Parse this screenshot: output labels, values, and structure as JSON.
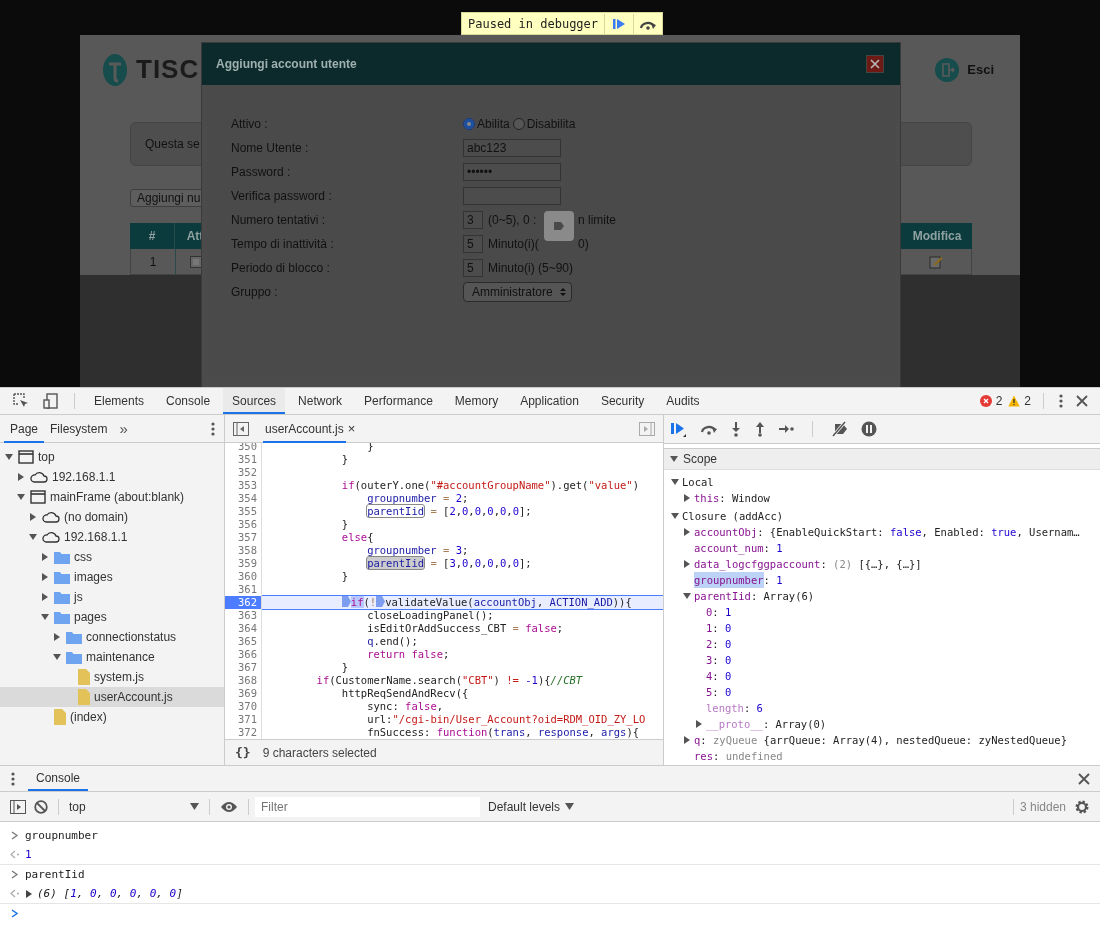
{
  "debugger_banner": {
    "text": "Paused in debugger"
  },
  "webpage": {
    "logo": "TISC",
    "logout": "Esci",
    "notice": "Questa se",
    "add_button": "Aggiungi nu",
    "table": {
      "columns": [
        "#",
        "Att",
        "Modifica"
      ],
      "rows": [
        {
          "cells": [
            "1"
          ],
          "enabled": true
        }
      ]
    }
  },
  "modal": {
    "title": "Aggiungi account utente",
    "fields": [
      {
        "kind": "radio",
        "label": "Attivo :",
        "options": [
          {
            "label": "Abilita",
            "selected": true
          },
          {
            "label": "Disabilita",
            "selected": false
          }
        ]
      },
      {
        "kind": "text",
        "label": "Nome Utente :",
        "value": "abc123"
      },
      {
        "kind": "text",
        "label": "Password :",
        "value": "••••••"
      },
      {
        "kind": "text",
        "label": "Verifica password :"
      },
      {
        "kind": "short",
        "label": "Numero tentativi :",
        "value": "3",
        "hint": "(0~5), 0 :",
        "hint_after": "n limite"
      },
      {
        "kind": "short",
        "label": "Tempo di inattività :",
        "value": "5",
        "hint": "Minuto(i)(",
        "hint_after": "0)"
      },
      {
        "kind": "short",
        "label": "Periodo di blocco :",
        "value": "5",
        "hint": "Minuto(i) (5~90)"
      },
      {
        "kind": "select",
        "label": "Gruppo :",
        "value": "Amministratore"
      }
    ]
  },
  "devtools": {
    "tabs": [
      {
        "label": "Elements",
        "selected": false
      },
      {
        "label": "Console",
        "selected": false
      },
      {
        "label": "Sources",
        "selected": true
      },
      {
        "label": "Network",
        "selected": false
      },
      {
        "label": "Performance",
        "selected": false
      },
      {
        "label": "Memory",
        "selected": false
      },
      {
        "label": "Application",
        "selected": false
      },
      {
        "label": "Security",
        "selected": false
      },
      {
        "label": "Audits",
        "selected": false
      }
    ],
    "errors": "2",
    "warnings": "2"
  },
  "navigator": {
    "tabs": [
      {
        "label": "Page",
        "selected": true
      },
      {
        "label": "Filesystem",
        "selected": false
      }
    ],
    "more": "»",
    "tree": [
      {
        "label": "top",
        "kind": "frame",
        "expanded": true,
        "selected": false,
        "children": [
          {
            "label": "192.168.1.1",
            "kind": "cloud",
            "expanded": false,
            "selected": false
          },
          {
            "label": "mainFrame (about:blank)",
            "kind": "frame",
            "expanded": true,
            "selected": false,
            "children": [
              {
                "label": "(no domain)",
                "kind": "cloud",
                "expanded": false,
                "selected": false
              },
              {
                "label": "192.168.1.1",
                "kind": "cloud",
                "expanded": true,
                "selected": false,
                "children": [
                  {
                    "label": "css",
                    "kind": "folder",
                    "expanded": false,
                    "selected": false
                  },
                  {
                    "label": "images",
                    "kind": "folder",
                    "expanded": false,
                    "selected": false
                  },
                  {
                    "label": "js",
                    "kind": "folder",
                    "expanded": false,
                    "selected": false
                  },
                  {
                    "label": "pages",
                    "kind": "folder",
                    "expanded": true,
                    "selected": false,
                    "children": [
                      {
                        "label": "connectionstatus",
                        "kind": "folder",
                        "expanded": false,
                        "selected": false
                      },
                      {
                        "label": "maintenance",
                        "kind": "folder",
                        "expanded": true,
                        "selected": false,
                        "children": [
                          {
                            "label": "system.js",
                            "kind": "file",
                            "selected": false
                          },
                          {
                            "label": "userAccount.js",
                            "kind": "file",
                            "selected": true
                          }
                        ]
                      }
                    ]
                  },
                  {
                    "label": "(index)",
                    "kind": "file",
                    "selected": false
                  }
                ]
              }
            ]
          }
        ]
      }
    ]
  },
  "editor": {
    "file_tab": "userAccount.js",
    "close": "×",
    "status": "9 characters selected",
    "pretty_print": "{}",
    "lines": [
      {
        "n": "350",
        "current": false,
        "tokens": [
          {
            "text": "                }",
            "kind": "plain"
          }
        ]
      },
      {
        "n": "351",
        "current": false,
        "tokens": [
          {
            "text": "            }",
            "kind": "plain"
          }
        ]
      },
      {
        "n": "352",
        "current": false
      },
      {
        "n": "353",
        "current": false,
        "tokens": [
          {
            "text": "            if",
            "kind": "keyword"
          },
          {
            "text": "(outerY.one(",
            "kind": "plain"
          },
          {
            "text": "\"#accountGroupName\"",
            "kind": "string"
          },
          {
            "text": ").get(",
            "kind": "plain"
          },
          {
            "text": "\"value\"",
            "kind": "string"
          },
          {
            "text": ")",
            "kind": "plain"
          }
        ]
      },
      {
        "n": "354",
        "current": false,
        "tokens": [
          {
            "text": "                groupnumber",
            "kind": "variable"
          },
          {
            "text": " = ",
            "kind": "operator"
          },
          {
            "text": "2",
            "kind": "number"
          },
          {
            "text": ";",
            "kind": "plain"
          }
        ]
      },
      {
        "n": "355",
        "current": false,
        "tokens": [
          {
            "text": "                parentIid",
            "kind": "variable",
            "boxed": true
          },
          {
            "text": " = ",
            "kind": "operator"
          },
          {
            "text": "[",
            "kind": "plain"
          },
          {
            "text": "2",
            "kind": "number"
          },
          {
            "text": ",",
            "kind": "plain"
          },
          {
            "text": "0",
            "kind": "number"
          },
          {
            "text": ",",
            "kind": "plain"
          },
          {
            "text": "0",
            "kind": "number"
          },
          {
            "text": ",",
            "kind": "plain"
          },
          {
            "text": "0",
            "kind": "number"
          },
          {
            "text": ",",
            "kind": "plain"
          },
          {
            "text": "0",
            "kind": "number"
          },
          {
            "text": ",",
            "kind": "plain"
          },
          {
            "text": "0",
            "kind": "number"
          },
          {
            "text": "];",
            "kind": "plain"
          }
        ]
      },
      {
        "n": "356",
        "current": false,
        "tokens": [
          {
            "text": "            }",
            "kind": "plain"
          }
        ]
      },
      {
        "n": "357",
        "current": false,
        "tokens": [
          {
            "text": "            else",
            "kind": "keyword"
          },
          {
            "text": "{",
            "kind": "plain"
          }
        ]
      },
      {
        "n": "358",
        "current": false,
        "tokens": [
          {
            "text": "                groupnumber",
            "kind": "variable"
          },
          {
            "text": " = ",
            "kind": "operator"
          },
          {
            "text": "3",
            "kind": "number"
          },
          {
            "text": ";",
            "kind": "plain"
          }
        ]
      },
      {
        "n": "359",
        "current": false,
        "tokens": [
          {
            "text": "                parentIid",
            "kind": "variable",
            "boxed": true,
            "selected": true
          },
          {
            "text": " = ",
            "kind": "operator"
          },
          {
            "text": "[",
            "kind": "plain"
          },
          {
            "text": "3",
            "kind": "number"
          },
          {
            "text": ",",
            "kind": "plain"
          },
          {
            "text": "0",
            "kind": "number"
          },
          {
            "text": ",",
            "kind": "plain"
          },
          {
            "text": "0",
            "kind": "number"
          },
          {
            "text": ",",
            "kind": "plain"
          },
          {
            "text": "0",
            "kind": "number"
          },
          {
            "text": ",",
            "kind": "plain"
          },
          {
            "text": "0",
            "kind": "number"
          },
          {
            "text": ",",
            "kind": "plain"
          },
          {
            "text": "0",
            "kind": "number"
          },
          {
            "text": "];",
            "kind": "plain"
          }
        ]
      },
      {
        "n": "360",
        "current": false,
        "tokens": [
          {
            "text": "            }",
            "kind": "plain"
          }
        ]
      },
      {
        "n": "361",
        "current": false
      },
      {
        "n": "362",
        "current": true,
        "tokens": [
          {
            "text": "            if",
            "kind": "keyword",
            "paused_here": true,
            "breakpoint_before": true
          },
          {
            "text": "(",
            "kind": "plain"
          },
          {
            "text": "!",
            "kind": "operator"
          },
          {
            "kind": "breakpoint"
          },
          {
            "text": "validateValue(",
            "kind": "plain"
          },
          {
            "text": "accountObj",
            "kind": "variable"
          },
          {
            "text": ", ",
            "kind": "plain"
          },
          {
            "text": "ACTION_ADD",
            "kind": "variable"
          },
          {
            "text": ")){",
            "kind": "plain"
          }
        ]
      },
      {
        "n": "363",
        "current": false,
        "tokens": [
          {
            "text": "                closeLoadingPanel();",
            "kind": "plain"
          }
        ]
      },
      {
        "n": "364",
        "current": false,
        "tokens": [
          {
            "text": "                isEditOrAddSuccess_CBT",
            "kind": "plain"
          },
          {
            "text": " = ",
            "kind": "operator"
          },
          {
            "text": "false",
            "kind": "keyword"
          },
          {
            "text": ";",
            "kind": "plain"
          }
        ]
      },
      {
        "n": "365",
        "current": false,
        "tokens": [
          {
            "text": "                q",
            "kind": "variable"
          },
          {
            "text": ".end();",
            "kind": "plain"
          }
        ]
      },
      {
        "n": "366",
        "current": false,
        "tokens": [
          {
            "text": "                return false",
            "kind": "keyword"
          },
          {
            "text": ";",
            "kind": "plain"
          }
        ]
      },
      {
        "n": "367",
        "current": false,
        "tokens": [
          {
            "text": "            }",
            "kind": "plain"
          }
        ]
      },
      {
        "n": "368",
        "current": false,
        "tokens": [
          {
            "text": "        if",
            "kind": "keyword"
          },
          {
            "text": "(CustomerName.search(",
            "kind": "plain"
          },
          {
            "text": "\"CBT\"",
            "kind": "string"
          },
          {
            "text": ") ",
            "kind": "plain"
          },
          {
            "text": "!=",
            "kind": "compare"
          },
          {
            "text": " -1",
            "kind": "number"
          },
          {
            "text": "){",
            "kind": "plain"
          },
          {
            "text": "//CBT",
            "kind": "comment"
          }
        ]
      },
      {
        "n": "369",
        "current": false,
        "tokens": [
          {
            "text": "            httpReqSendAndRecv({",
            "kind": "plain"
          }
        ]
      },
      {
        "n": "370",
        "current": false,
        "tokens": [
          {
            "text": "                sync: ",
            "kind": "plain"
          },
          {
            "text": "false",
            "kind": "keyword"
          },
          {
            "text": ",",
            "kind": "plain"
          }
        ]
      },
      {
        "n": "371",
        "current": false,
        "tokens": [
          {
            "text": "                url:",
            "kind": "plain"
          },
          {
            "text": "\"/cgi-bin/User_Account?oid=RDM_OID_ZY_LO",
            "kind": "string"
          }
        ]
      },
      {
        "n": "372",
        "current": false,
        "tokens": [
          {
            "text": "                fnSuccess: ",
            "kind": "plain"
          },
          {
            "text": "function",
            "kind": "keyword"
          },
          {
            "text": "(",
            "kind": "plain"
          },
          {
            "text": "trans",
            "kind": "variable"
          },
          {
            "text": ", ",
            "kind": "plain"
          },
          {
            "text": "response",
            "kind": "variable"
          },
          {
            "text": ", ",
            "kind": "plain"
          },
          {
            "text": "args",
            "kind": "variable"
          },
          {
            "text": "){",
            "kind": "plain"
          }
        ]
      }
    ]
  },
  "scope": {
    "title": "Scope",
    "sections": [
      {
        "title": "Local",
        "entries": [
          {
            "name": "this",
            "internal": false,
            "highlighted": false,
            "expanded": false,
            "value": [
              {
                "text": ": Window",
                "kind": "plain"
              }
            ]
          }
        ]
      },
      {
        "title": "Closure (addAcc)",
        "entries": [
          {
            "name": "accountObj",
            "internal": false,
            "highlighted": false,
            "expanded": false,
            "value": [
              {
                "text": ": {EnableQuickStart: ",
                "kind": "plain"
              },
              {
                "text": "false",
                "kind": "number"
              },
              {
                "text": ", Enabled: ",
                "kind": "plain"
              },
              {
                "text": "true",
                "kind": "number"
              },
              {
                "text": ", Usernam…",
                "kind": "plain"
              }
            ]
          },
          {
            "name": "account_num",
            "internal": false,
            "highlighted": false,
            "value": [
              {
                "text": ": ",
                "kind": "plain"
              },
              {
                "text": "1",
                "kind": "number"
              }
            ]
          },
          {
            "name": "data_logcfggpaccount",
            "internal": false,
            "highlighted": false,
            "expanded": false,
            "value": [
              {
                "text": ": ",
                "kind": "plain"
              },
              {
                "text": "(2) ",
                "kind": "grey"
              },
              {
                "text": "[{…}, {…}]",
                "kind": "plain"
              }
            ]
          },
          {
            "name": "groupnumber",
            "internal": false,
            "highlighted": true,
            "value": [
              {
                "text": ": ",
                "kind": "plain"
              },
              {
                "text": "1",
                "kind": "number"
              }
            ]
          },
          {
            "name": "parentIid",
            "internal": false,
            "highlighted": false,
            "expanded": true,
            "value": [
              {
                "text": ": Array(6)",
                "kind": "plain"
              }
            ],
            "children": [
              {
                "name": "0",
                "internal": false,
                "highlighted": false,
                "value": [
                  {
                    "text": ": ",
                    "kind": "plain"
                  },
                  {
                    "text": "1",
                    "kind": "number"
                  }
                ]
              },
              {
                "name": "1",
                "internal": false,
                "highlighted": false,
                "value": [
                  {
                    "text": ": ",
                    "kind": "plain"
                  },
                  {
                    "text": "0",
                    "kind": "number"
                  }
                ]
              },
              {
                "name": "2",
                "internal": false,
                "highlighted": false,
                "value": [
                  {
                    "text": ": ",
                    "kind": "plain"
                  },
                  {
                    "text": "0",
                    "kind": "number"
                  }
                ]
              },
              {
                "name": "3",
                "internal": false,
                "highlighted": false,
                "value": [
                  {
                    "text": ": ",
                    "kind": "plain"
                  },
                  {
                    "text": "0",
                    "kind": "number"
                  }
                ]
              },
              {
                "name": "4",
                "internal": false,
                "highlighted": false,
                "value": [
                  {
                    "text": ": ",
                    "kind": "plain"
                  },
                  {
                    "text": "0",
                    "kind": "number"
                  }
                ]
              },
              {
                "name": "5",
                "internal": false,
                "highlighted": false,
                "value": [
                  {
                    "text": ": ",
                    "kind": "plain"
                  },
                  {
                    "text": "0",
                    "kind": "number"
                  }
                ]
              },
              {
                "name": "length",
                "internal": true,
                "highlighted": false,
                "value": [
                  {
                    "text": ": ",
                    "kind": "plain"
                  },
                  {
                    "text": "6",
                    "kind": "number"
                  }
                ]
              },
              {
                "name": "__proto__",
                "internal": true,
                "highlighted": false,
                "expanded": false,
                "value": [
                  {
                    "text": ": Array(0)",
                    "kind": "plain"
                  }
                ]
              }
            ]
          },
          {
            "name": "q",
            "internal": false,
            "highlighted": false,
            "expanded": false,
            "value": [
              {
                "text": ": ",
                "kind": "plain"
              },
              {
                "text": "zyQueue ",
                "kind": "grey"
              },
              {
                "text": "{arrQueue: Array(4), nestedQueue: zyNestedQueue}",
                "kind": "plain"
              }
            ]
          },
          {
            "name": "res",
            "internal": false,
            "highlighted": false,
            "value": [
              {
                "text": ": ",
                "kind": "plain"
              },
              {
                "text": "undefined",
                "kind": "grey"
              }
            ]
          }
        ]
      }
    ]
  },
  "console": {
    "tab": "Console",
    "context": "top",
    "filter_placeholder": "Filter",
    "levels": "Default levels",
    "hidden": "3 hidden",
    "messages": [
      {
        "kind": "input",
        "tokens": [
          {
            "text": "groupnumber",
            "kind": "plain"
          }
        ]
      },
      {
        "kind": "result",
        "tokens": [
          {
            "text": "1",
            "kind": "number"
          }
        ]
      },
      {
        "kind": "input",
        "tokens": [
          {
            "text": "parentIid",
            "kind": "plain"
          }
        ]
      },
      {
        "kind": "result",
        "expanded": false,
        "tokens": [
          {
            "text": "(6) [",
            "kind": "preview"
          },
          {
            "text": "1",
            "kind": "preview_number"
          },
          {
            "text": ", ",
            "kind": "preview"
          },
          {
            "text": "0",
            "kind": "preview_number"
          },
          {
            "text": ", ",
            "kind": "preview"
          },
          {
            "text": "0",
            "kind": "preview_number"
          },
          {
            "text": ", ",
            "kind": "preview"
          },
          {
            "text": "0",
            "kind": "preview_number"
          },
          {
            "text": ", ",
            "kind": "preview"
          },
          {
            "text": "0",
            "kind": "preview_number"
          },
          {
            "text": ", ",
            "kind": "preview"
          },
          {
            "text": "0",
            "kind": "preview_number"
          },
          {
            "text": "]",
            "kind": "preview"
          }
        ]
      }
    ]
  }
}
